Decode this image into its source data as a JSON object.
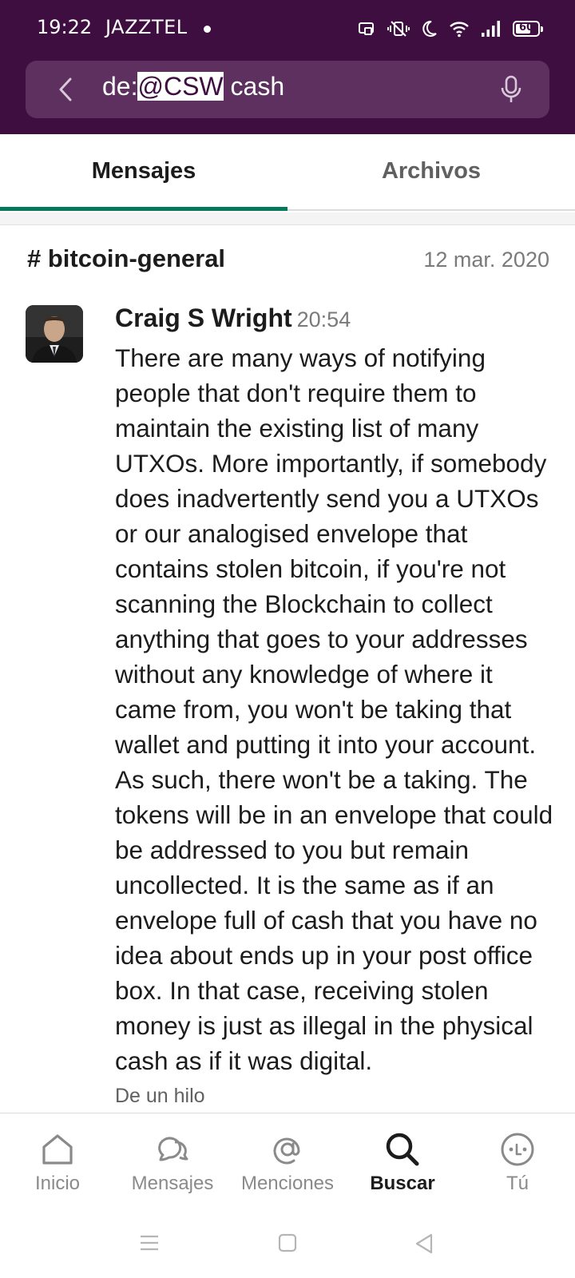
{
  "status_bar": {
    "time": "19:22",
    "carrier": "JAZZTEL",
    "battery": "60"
  },
  "search": {
    "prefix": "de:",
    "selected": "@CSW",
    "suffix": " cash"
  },
  "tabs": [
    {
      "label": "Mensajes",
      "active": true
    },
    {
      "label": "Archivos",
      "active": false
    }
  ],
  "result": {
    "channel": "# bitcoin-general",
    "date": "12 mar. 2020",
    "author": "Craig S Wright",
    "time": "20:54",
    "message": "There are many ways of notifying people that don't require them to maintain the existing list of many UTXOs. More importantly, if somebody does inadvertently send you a UTXOs or our analogised envelope that contains stolen bitcoin, if you're not scanning the Blockchain to collect anything that goes to your addresses without any knowledge of where it came from, you won't be taking that wallet and putting it into your account. As such, there won't be a taking. The tokens will be in an envelope that could be addressed to you but remain uncollected. It is the same as if an envelope full of cash that you have no idea about ends up in your post office box. In that case, receiving stolen money is just as illegal in the physical cash as if it was digital.",
    "thread_note": "De un hilo"
  },
  "bottom_nav": [
    {
      "label": "Inicio",
      "icon": "home-icon",
      "active": false
    },
    {
      "label": "Mensajes",
      "icon": "messages-icon",
      "active": false
    },
    {
      "label": "Menciones",
      "icon": "mentions-icon",
      "active": false
    },
    {
      "label": "Buscar",
      "icon": "search-icon",
      "active": true
    },
    {
      "label": "Tú",
      "icon": "you-icon",
      "active": false
    }
  ],
  "colors": {
    "brand_purple": "#3f0e40",
    "tab_underline": "#007a5a"
  }
}
